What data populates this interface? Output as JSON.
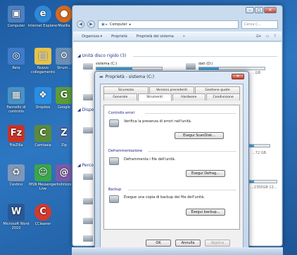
{
  "desktop": {
    "icons": [
      {
        "label": "Computer",
        "icon": "computer-icon",
        "color": "#4d7fbf"
      },
      {
        "label": "Internet Explorer",
        "icon": "ie-icon",
        "color": "#2f88d6"
      },
      {
        "label": "Mozilla",
        "icon": "firefox-icon",
        "color": "#d66a1f"
      },
      {
        "label": "Rete",
        "icon": "network-icon",
        "color": "#3f7bc8"
      },
      {
        "label": "Nuovo collegamento",
        "icon": "document-icon",
        "color": "#e5c24b"
      },
      {
        "label": "Strum...",
        "icon": "tools-icon",
        "color": "#6a8fb8"
      },
      {
        "label": "Pannello di controllo",
        "icon": "control-panel-icon",
        "color": "#4a92c4"
      },
      {
        "label": "Dropbox",
        "icon": "dropbox-icon",
        "color": "#2a8ddf"
      },
      {
        "label": "Google",
        "icon": "google-icon",
        "color": "#5c9a3a"
      },
      {
        "label": "FileZilla",
        "icon": "filezilla-icon",
        "color": "#c93327"
      },
      {
        "label": "Camtasia",
        "icon": "camtasia-icon",
        "color": "#5b8a3b"
      },
      {
        "label": "Zip",
        "icon": "zip-icon",
        "color": "#3e6fb5"
      },
      {
        "label": "Cestino",
        "icon": "recycle-bin-icon",
        "color": "#7f98b8"
      },
      {
        "label": "MSN Messenger Live",
        "icon": "messenger-icon",
        "color": "#3aa64a"
      },
      {
        "label": "Indirizzo",
        "icon": "addressbook-icon",
        "color": "#7a5aa8"
      },
      {
        "label": "Microsoft Word 2010",
        "icon": "word-icon",
        "color": "#2b5797"
      },
      {
        "label": "CCleaner",
        "icon": "ccleaner-icon",
        "color": "#d23a2e"
      }
    ]
  },
  "explorer": {
    "nav_back": "◀",
    "nav_forward": "▶",
    "breadcrumb": "Computer",
    "search_placeholder": "Cerca C...",
    "toolbar": {
      "organize": "Organizza ▾",
      "properties": "Proprietà",
      "system_properties": "Proprietà del sistema",
      "more": "»"
    },
    "group_hdd": "Unità disco rigido (3)",
    "group_removable": "Dispo",
    "group_other": "Perco",
    "drives": [
      {
        "name": "sistema (C:)",
        "used_fraction": 0.55
      },
      {
        "name": "dati (D:)",
        "used_fraction": 0.3,
        "free": "...GB"
      },
      {
        "name": "",
        "used_fraction": 0.2,
        "free": "...72 GB"
      },
      {
        "name": "",
        "used_fraction": 0.15,
        "free": "...2350GB 12..."
      }
    ]
  },
  "dialog": {
    "title": "Proprietà - sistema (C:)",
    "close_glyph": "✕",
    "tabs_row1": [
      "Sicurezza",
      "Versioni precedenti",
      "Gestione quote"
    ],
    "tabs_row2": [
      "Generale",
      "Strumenti",
      "Hardware",
      "Condivisione"
    ],
    "sections": {
      "check": {
        "title": "Controllo errori",
        "text": "Verifica la presenza di errori nell'unità.",
        "button": "Esegui ScanDisk..."
      },
      "defrag": {
        "title": "Deframmentazione",
        "text": "Deframmenta i file dell'unità.",
        "button": "Esegui Defrag..."
      },
      "backup": {
        "title": "Backup",
        "text": "Esegue una copia di backup dei file dell'unità.",
        "button": "Esegui backup..."
      }
    },
    "ok": "OK",
    "cancel": "Annulla",
    "apply": "Applica"
  }
}
